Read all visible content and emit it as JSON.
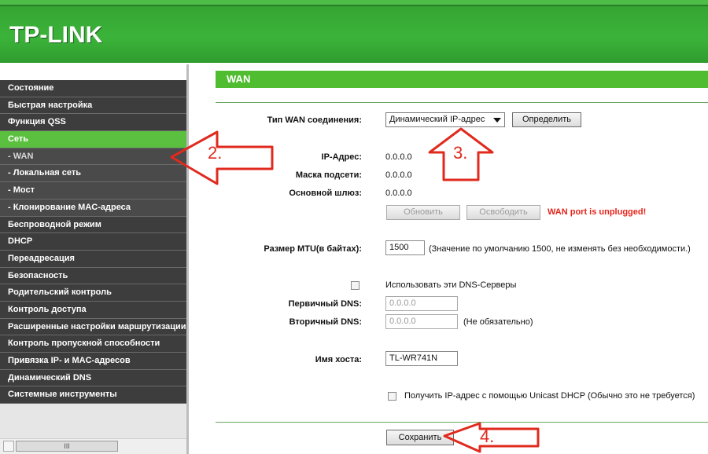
{
  "header": {
    "logo": "TP-LINK"
  },
  "sidebar": {
    "items": [
      {
        "label": "Состояние"
      },
      {
        "label": "Быстрая настройка"
      },
      {
        "label": "Функция QSS"
      },
      {
        "label": "Сеть"
      },
      {
        "label": "- WAN"
      },
      {
        "label": "- Локальная сеть"
      },
      {
        "label": "- Мост"
      },
      {
        "label": "- Клонирование MAC-адреса"
      },
      {
        "label": "Беспроводной режим"
      },
      {
        "label": "DHCP"
      },
      {
        "label": "Переадресация"
      },
      {
        "label": "Безопасность"
      },
      {
        "label": "Родительский контроль"
      },
      {
        "label": "Контроль доступа"
      },
      {
        "label": "Расширенные настройки маршрутизации"
      },
      {
        "label": "Контроль пропускной способности"
      },
      {
        "label": "Привязка IP- и MAC-адресов"
      },
      {
        "label": "Динамический DNS"
      },
      {
        "label": "Системные инструменты"
      }
    ],
    "scroll_thumb": "III"
  },
  "main": {
    "section_title": "WAN",
    "wan_type_label": "Тип WAN соединения:",
    "wan_type_value": "Динамический IP-адрес",
    "detect_button": "Определить",
    "ip_label": "IP-Адрес:",
    "ip_value": "0.0.0.0",
    "mask_label": "Маска подсети:",
    "mask_value": "0.0.0.0",
    "gateway_label": "Основной шлюз:",
    "gateway_value": "0.0.0.0",
    "renew_button": "Обновить",
    "release_button": "Освободить",
    "wan_status": "WAN port is unplugged!",
    "mtu_label": "Размер MTU(в байтах):",
    "mtu_value": "1500",
    "mtu_hint": "(Значение по умолчанию 1500, не изменять без необходимости.)",
    "use_dns_label": "Использовать эти DNS-Серверы",
    "primary_dns_label": "Первичный DNS:",
    "primary_dns_value": "0.0.0.0",
    "secondary_dns_label": "Вторичный DNS:",
    "secondary_dns_value": "0.0.0.0",
    "secondary_dns_hint": "(Не обязательно)",
    "hostname_label": "Имя хоста:",
    "hostname_value": "TL-WR741N",
    "unicast_label": "Получить IP-адрес с помощью Unicast DHCP (Обычно это не требуется)",
    "save_button": "Сохранить"
  },
  "annotations": {
    "arrow2": "2.",
    "arrow3": "3.",
    "arrow4": "4."
  },
  "colors": {
    "brand_green": "#3bb33a",
    "active_menu": "#5bc040",
    "menu_dark": "#3d3d3d",
    "annotation_red": "#e02a1e"
  }
}
